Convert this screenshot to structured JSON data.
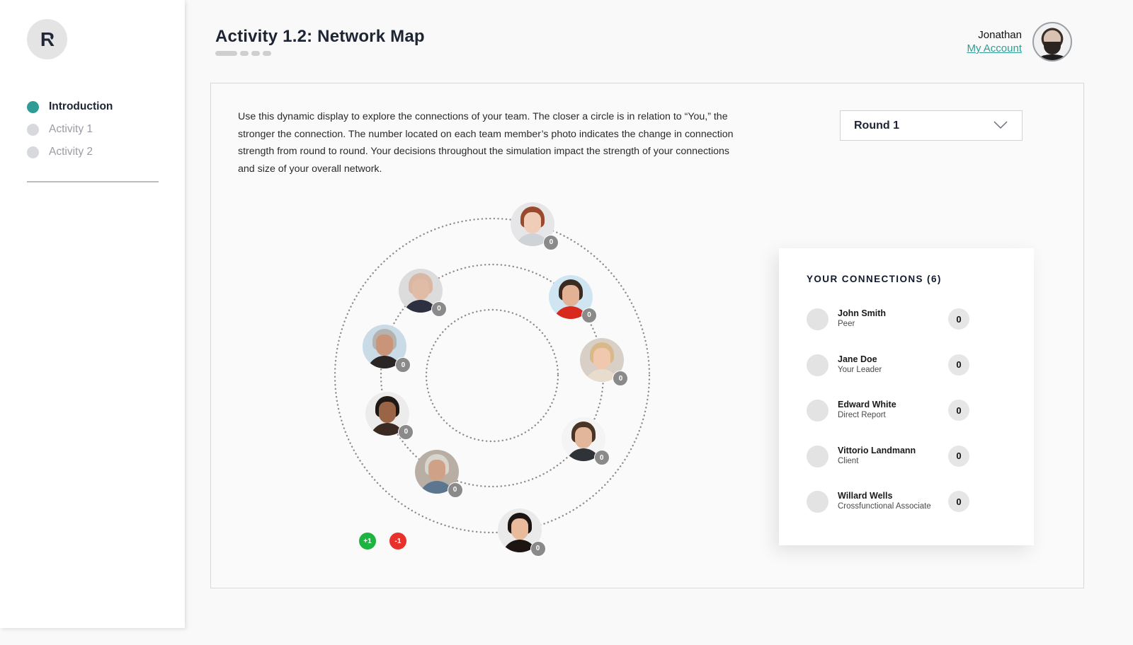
{
  "sidebar": {
    "logo_letter": "R",
    "nav": [
      {
        "label": "Introduction",
        "active": true
      },
      {
        "label": "Activity 1",
        "active": false
      },
      {
        "label": "Activity 2",
        "active": false
      }
    ]
  },
  "header": {
    "title": "Activity 1.2: Network Map",
    "progress_steps": 4,
    "progress_current": 1
  },
  "account": {
    "name": "Jonathan",
    "link_label": "My Account"
  },
  "main": {
    "intro": "Use this dynamic display to explore the connections of your team. The closer a circle is in relation to “You,” the stronger the connection. The number located on each team member’s photo indicates the change in connection strength from round to round. Your decisions throughout the simulation impact the strength of your connections and size of your overall network.",
    "round_select": {
      "selected": "Round 1"
    }
  },
  "network": {
    "rings": 3,
    "members": [
      {
        "ring": 3,
        "angle_deg": 75,
        "change": "0",
        "theme": "redhead-woman"
      },
      {
        "ring": 2,
        "angle_deg": 130,
        "change": "0",
        "theme": "bald-man-glasses"
      },
      {
        "ring": 2,
        "angle_deg": 45,
        "change": "0",
        "theme": "smiling-man-red-shirt"
      },
      {
        "ring": 2,
        "angle_deg": 165,
        "change": "0",
        "theme": "grey-haired-woman"
      },
      {
        "ring": 2,
        "angle_deg": 8,
        "change": "0",
        "theme": "blonde-woman-glasses"
      },
      {
        "ring": 2,
        "angle_deg": 200,
        "change": "0",
        "theme": "dark-haired-woman"
      },
      {
        "ring": 2,
        "angle_deg": -35,
        "change": "0",
        "theme": "man-in-suit"
      },
      {
        "ring": 2,
        "angle_deg": 240,
        "change": "0",
        "theme": "older-man-beard"
      },
      {
        "ring": 3,
        "angle_deg": -80,
        "change": "0",
        "theme": "young-woman-dark-hair"
      }
    ],
    "legend": [
      {
        "label": "+1",
        "color": "#1db43f"
      },
      {
        "label": "-1",
        "color": "#e8312a"
      }
    ]
  },
  "connections": {
    "title": "YOUR CONNECTIONS (6)",
    "items": [
      {
        "name": "John Smith",
        "role": "Peer",
        "score": "0"
      },
      {
        "name": "Jane Doe",
        "role": "Your Leader",
        "score": "0"
      },
      {
        "name": "Edward White",
        "role": "Direct Report",
        "score": "0"
      },
      {
        "name": "Vittorio Landmann",
        "role": "Client",
        "score": "0"
      },
      {
        "name": "Willard Wells",
        "role": "Crossfunctional Associate",
        "score": "0"
      }
    ]
  },
  "colors": {
    "accent": "#2f9c95",
    "text_dark": "#1d2433",
    "badge_neutral": "#8a8a8a",
    "positive": "#1db43f",
    "negative": "#e8312a"
  }
}
